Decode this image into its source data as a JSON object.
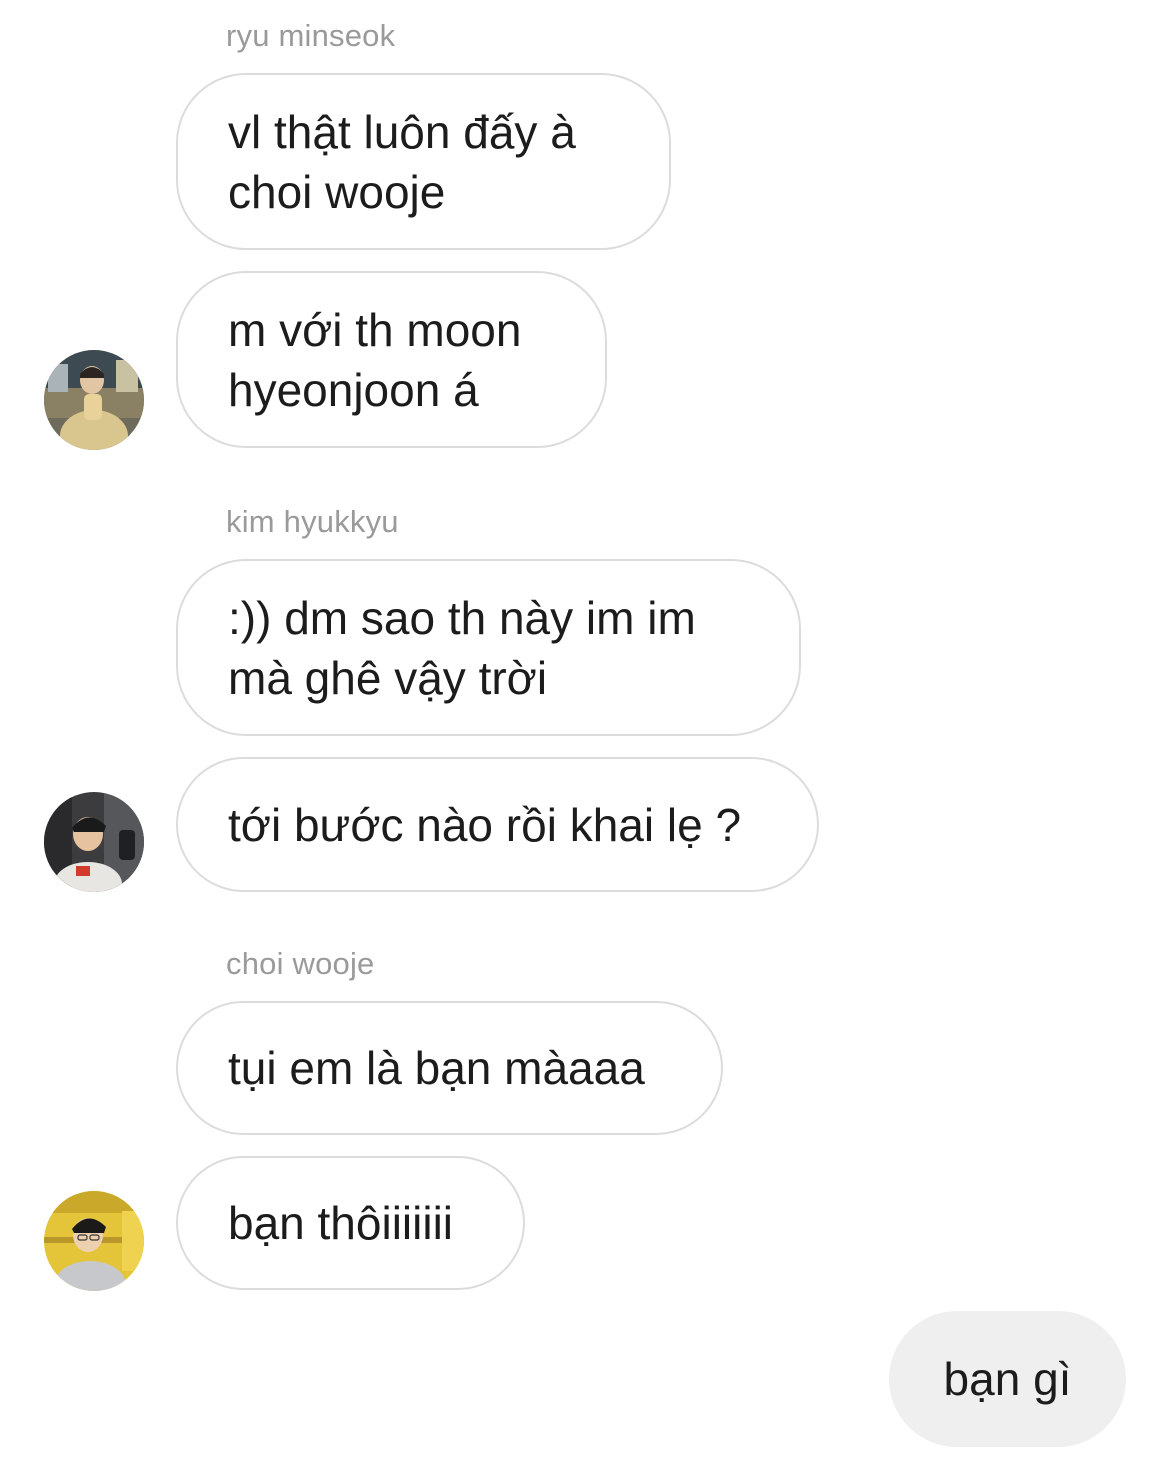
{
  "conversation": {
    "groups": [
      {
        "sender": "ryu minseok",
        "messages": [
          {
            "lines": [
              "vl thật luôn đấy à",
              "choi wooje"
            ]
          },
          {
            "lines": [
              "m với th moon",
              "hyeonjoon á"
            ]
          }
        ],
        "avatar_icon": "avatar-photo-beige-coat-icon"
      },
      {
        "sender": "kim hyukkyu",
        "messages": [
          {
            "lines": [
              ":)) dm sao th này im im",
              "mà ghê vậy trời"
            ]
          },
          {
            "lines": [
              "tới bước nào rồi khai lẹ ?"
            ]
          }
        ],
        "avatar_icon": "avatar-photo-gamer-headphones-icon"
      },
      {
        "sender": "choi wooje",
        "messages": [
          {
            "lines": [
              "tụi em là bạn màaaa"
            ]
          },
          {
            "lines": [
              "bạn thôiiiiiii"
            ]
          }
        ],
        "avatar_icon": "avatar-photo-yellow-stadium-icon"
      }
    ],
    "outgoing": {
      "text": "bạn gì"
    }
  },
  "colors": {
    "background": "#ffffff",
    "bubble_border": "#dcdcdc",
    "outgoing_bubble": "#efefef",
    "sender_name": "#9a9a9a",
    "text": "#1c1c1c"
  }
}
